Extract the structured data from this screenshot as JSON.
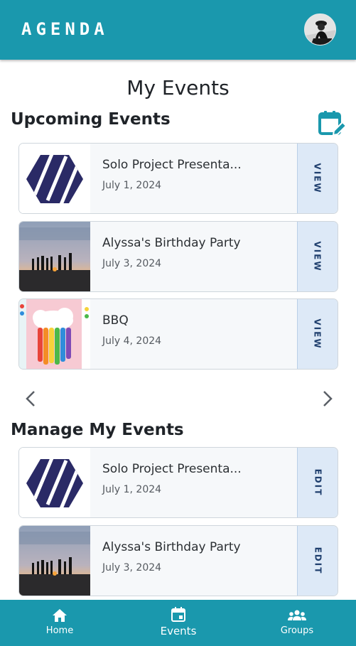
{
  "app": {
    "brand": "AGENDA"
  },
  "page": {
    "title": "My Events"
  },
  "upcoming": {
    "title": "Upcoming Events",
    "action_label": "VIEW",
    "events": [
      {
        "title": "Solo Project Presenta...",
        "date": "July 1, 2024",
        "thumb": "hexagon-logo"
      },
      {
        "title": "Alyssa's Birthday Party",
        "date": "July 3, 2024",
        "thumb": "beach-sunset-photo"
      },
      {
        "title": "BBQ",
        "date": "July 4, 2024",
        "thumb": "rainbow-cloud-craft-photo"
      }
    ]
  },
  "manage": {
    "title": "Manage My Events",
    "action_label": "EDIT",
    "events": [
      {
        "title": "Solo Project Presenta...",
        "date": "July 1, 2024",
        "thumb": "hexagon-logo"
      },
      {
        "title": "Alyssa's Birthday Party",
        "date": "July 3, 2024",
        "thumb": "beach-sunset-photo"
      }
    ]
  },
  "nav": {
    "items": [
      {
        "label": "Home",
        "icon": "home-icon"
      },
      {
        "label": "Events",
        "icon": "calendar-icon"
      },
      {
        "label": "Groups",
        "icon": "groups-icon"
      }
    ],
    "active": "Events"
  },
  "colors": {
    "brand": "#1a98ad",
    "card_action_bg": "#dde9f7",
    "logo_navy": "#2a2a66"
  }
}
